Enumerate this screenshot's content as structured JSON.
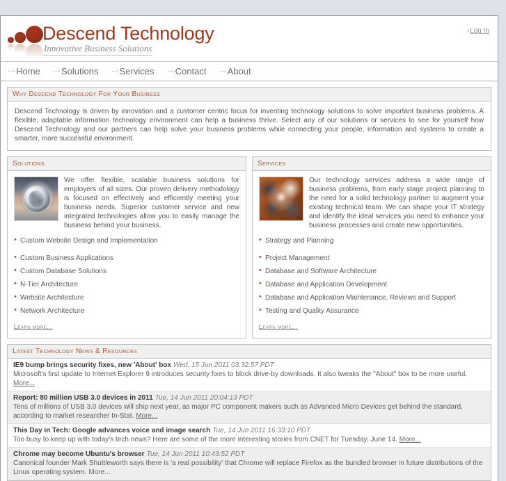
{
  "header": {
    "logo_title": "Descend Technology",
    "logo_tagline": "Innovative Business Solutions",
    "login_label": "Log In",
    "login_arrow": "›"
  },
  "nav": {
    "arrow": "····›",
    "items": [
      {
        "label": "Home"
      },
      {
        "label": "Solutions"
      },
      {
        "label": "Services"
      },
      {
        "label": "Contact"
      },
      {
        "label": "About"
      }
    ]
  },
  "intro": {
    "heading": "Why Descend Technology For Your Business",
    "body": "Descend Technology is driven by innovation and a customer centric focus for inventing technology solutions to solve important business problems. A flexible, adaptable information technology environment can help a business thrive. Select any of our solutions or services to see for yourself how Descend Technology and our partners can help solve your business problems while connecting your people, information and systems to create a smarter, more successful environment."
  },
  "solutions": {
    "heading": "Solutions",
    "body": "We offer flexible, scalable business solutions for employers of all sizes. Our proven delivery methodology is focused on effectively and efficiently meeting your business needs. Superior customer service and new integrated technologies allow you to easily manage the business behind your business.",
    "bullets": [
      "Custom Website Design and Implementation",
      "Custom Business Applications",
      "Custom Database Solutions",
      "N-Tier Architecture",
      "Website Architecture",
      "Network Architecture"
    ],
    "learn_more": "Learn more..."
  },
  "services": {
    "heading": "Services",
    "body": "Our technology services address a wide range of business problems, from early stage project planning to the need for a solid technology partner to augment your existing technical team. We can shape your IT strategy and identify the ideal services you need to enhance your business processes and create new opportunities.",
    "bullets": [
      "Strategy and Planning",
      "Project Management",
      "Database and Software Architecture",
      "Database and Application Development",
      "Database and Application Maintenance, Reviews and Support",
      "Testing and Quality Assurance"
    ],
    "learn_more": "Learn more..."
  },
  "news": {
    "heading": "Latest Technology News & Resources",
    "more_label": "More...",
    "items": [
      {
        "title": "IE9 bump brings security fixes, new 'About' box",
        "date": "Wed, 15 Jun 2011 03:32:57 PDT",
        "desc": "Microsoft's first update to Internet Explorer 9 introduces security fixes to block drive-by downloads. It also tweaks the \"About\" box to be more useful.",
        "more": "More..."
      },
      {
        "title": "Report: 80 million USB 3.0 devices in 2011",
        "date": "Tue, 14 Jun 2011 20:04:13 PDT",
        "desc": "Tens of millions of USB 3.0 devices will ship next year, as major PC component makers such as Advanced Micro Devices get behind the standard, according to market researcher In-Stat.",
        "more": "More..."
      },
      {
        "title": "This Day in Tech: Google advances voice and image search",
        "date": "Tue, 14 Jun 2011 16:33:10 PDT",
        "desc": "Too busy to keep up with today's tech news? Here are some of the more interesting stories from CNET for Tuesday, June 14.",
        "more": "More..."
      },
      {
        "title": "Chrome may become Ubuntu's browser",
        "date": "Tue, 14 Jun 2011 10:43:52 PDT",
        "desc": "Canonical founder Mark Shuttleworth says there is 'a real possibility' that Chrome will replace Firefox as the bundled browser in future distributions of the Linux operating system.",
        "more": "More..."
      }
    ]
  },
  "colors": {
    "brand": "#a0381c",
    "accent": "#b3552e",
    "page_bg": "#dfe1ea",
    "panel_border": "#c2c2c2",
    "panel_head_bg": "#f0f0f0"
  }
}
